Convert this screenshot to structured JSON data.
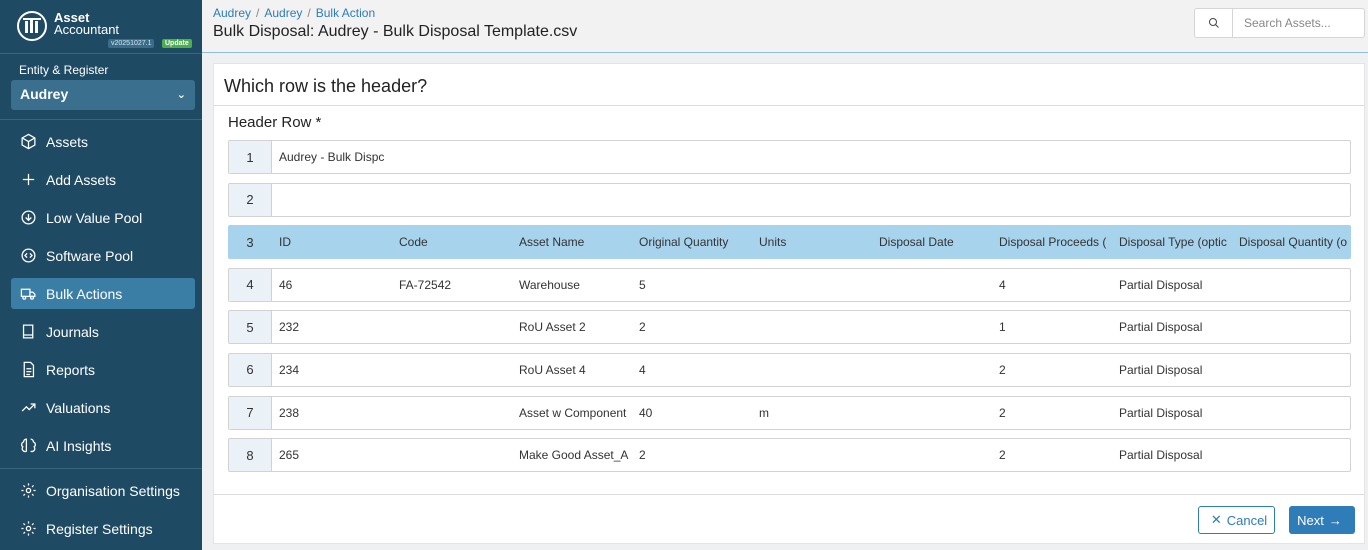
{
  "brand": {
    "name_line1": "Asset",
    "name_line2": "Accountant",
    "version": "v20251027.1",
    "update_label": "Update"
  },
  "entity": {
    "label": "Entity & Register",
    "selected": "Audrey"
  },
  "nav": [
    {
      "label": "Assets",
      "icon": "cube-icon"
    },
    {
      "label": "Add Assets",
      "icon": "plus-icon"
    },
    {
      "label": "Low Value Pool",
      "icon": "arrow-circle-down-icon"
    },
    {
      "label": "Software Pool",
      "icon": "code-circle-icon"
    },
    {
      "label": "Bulk Actions",
      "icon": "truck-icon",
      "active": true
    },
    {
      "label": "Journals",
      "icon": "book-icon"
    },
    {
      "label": "Reports",
      "icon": "document-icon"
    },
    {
      "label": "Valuations",
      "icon": "trend-up-icon"
    },
    {
      "label": "AI Insights",
      "icon": "brain-icon"
    }
  ],
  "nav_bottom": [
    {
      "label": "Organisation Settings",
      "icon": "gear-icon"
    },
    {
      "label": "Register Settings",
      "icon": "gear-icon"
    }
  ],
  "header": {
    "breadcrumbs": [
      "Audrey",
      "Audrey",
      "Bulk Action"
    ],
    "title": "Bulk Disposal: Audrey - Bulk Disposal Template.csv",
    "search_placeholder": "Search Assets..."
  },
  "card": {
    "title": "Which row is the header?",
    "field_label": "Header Row *"
  },
  "rows": [
    {
      "num": "1",
      "cells": [
        "Audrey - Bulk Dispc"
      ]
    },
    {
      "num": "2",
      "cells": []
    },
    {
      "num": "3",
      "header": true,
      "cells": [
        "ID",
        "Code",
        "Asset Name",
        "Original Quantity",
        "Units",
        "Disposal Date",
        "Disposal Proceeds (",
        "Disposal Type (optic",
        "Disposal Quantity (o"
      ]
    },
    {
      "num": "4",
      "cells": [
        "46",
        "FA-72542",
        "Warehouse",
        "5",
        "",
        "",
        "4",
        "Partial Disposal",
        ""
      ]
    },
    {
      "num": "5",
      "cells": [
        "232",
        "",
        "RoU Asset 2",
        "2",
        "",
        "",
        "1",
        "Partial Disposal",
        ""
      ]
    },
    {
      "num": "6",
      "cells": [
        "234",
        "",
        "RoU Asset 4",
        "4",
        "",
        "",
        "2",
        "Partial Disposal",
        ""
      ]
    },
    {
      "num": "7",
      "cells": [
        "238",
        "",
        "Asset w Component",
        "40",
        "m",
        "",
        "2",
        "Partial Disposal",
        ""
      ]
    },
    {
      "num": "8",
      "cells": [
        "265",
        "",
        "Make Good Asset_A",
        "2",
        "",
        "",
        "2",
        "Partial Disposal",
        ""
      ]
    }
  ],
  "footer": {
    "cancel_label": "Cancel",
    "next_label": "Next"
  },
  "colors": {
    "sidebar": "#1f4a63",
    "accent": "#2e7cb8",
    "header_row": "#a7d3ec",
    "active_nav": "#3a7ea6"
  }
}
